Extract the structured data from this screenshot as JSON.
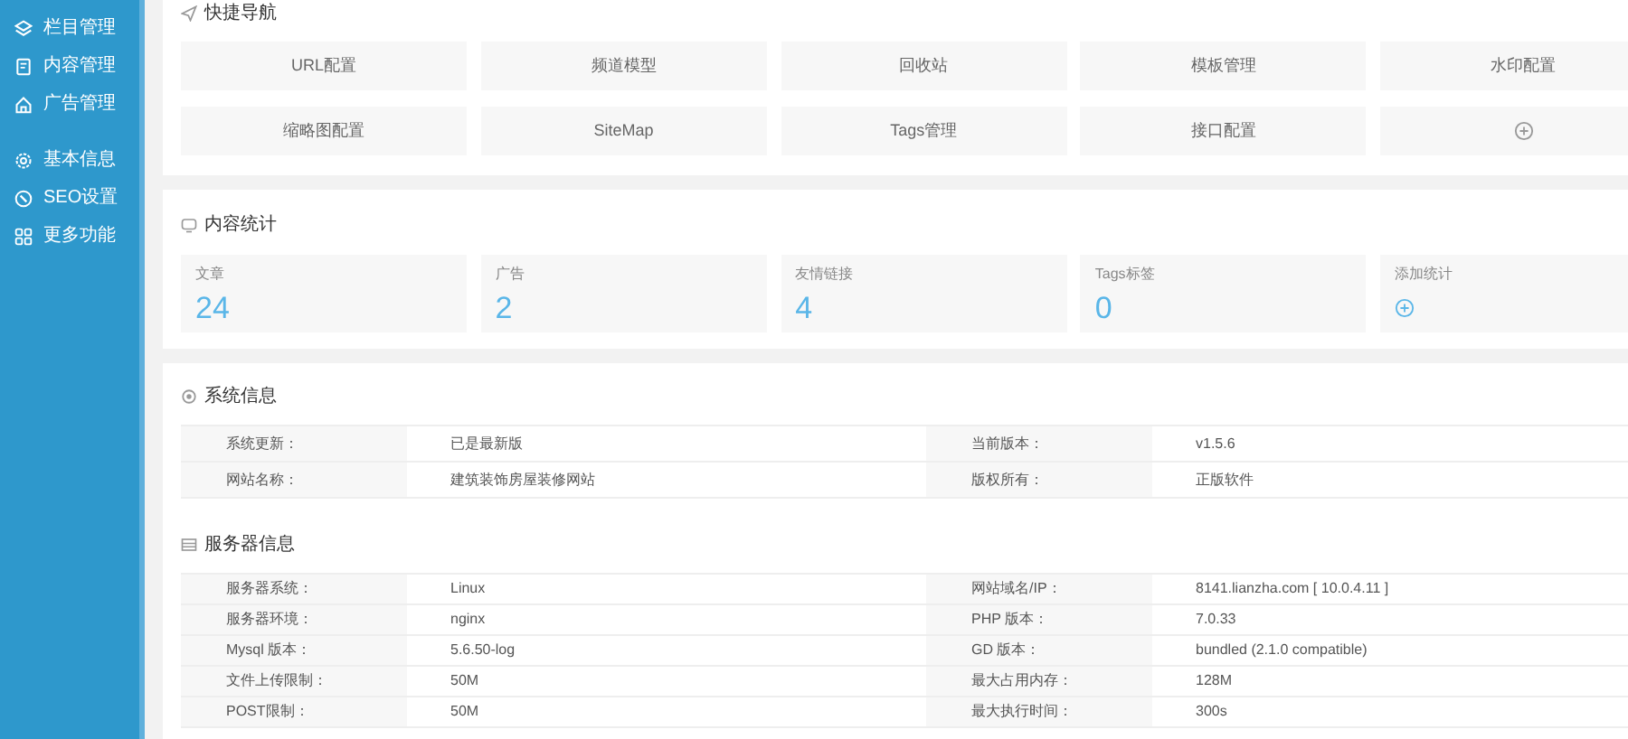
{
  "sidebar": {
    "groups": [
      {
        "items": [
          {
            "label": "栏目管理"
          },
          {
            "label": "内容管理"
          },
          {
            "label": "广告管理"
          }
        ]
      },
      {
        "items": [
          {
            "label": "基本信息"
          },
          {
            "label": "SEO设置"
          },
          {
            "label": "更多功能"
          }
        ]
      }
    ]
  },
  "quick_nav": {
    "title": "快捷导航",
    "items": [
      {
        "kind": "link",
        "label": "URL配置"
      },
      {
        "kind": "link",
        "label": "频道模型"
      },
      {
        "kind": "link",
        "label": "回收站"
      },
      {
        "kind": "link",
        "label": "模板管理"
      },
      {
        "kind": "link",
        "label": "水印配置"
      },
      {
        "kind": "link",
        "label": "缩略图配置"
      },
      {
        "kind": "link",
        "label": "SiteMap"
      },
      {
        "kind": "link",
        "label": "Tags管理"
      },
      {
        "kind": "link",
        "label": "接口配置"
      },
      {
        "kind": "add"
      }
    ]
  },
  "content_stats": {
    "title": "内容统计",
    "items": [
      {
        "kind": "stat",
        "label": "文章",
        "value": "24"
      },
      {
        "kind": "stat",
        "label": "广告",
        "value": "2"
      },
      {
        "kind": "stat",
        "label": "友情链接",
        "value": "4"
      },
      {
        "kind": "stat",
        "label": "Tags标签",
        "value": "0"
      },
      {
        "kind": "add",
        "label": "添加统计"
      }
    ]
  },
  "system_info": {
    "title": "系统信息",
    "rows": [
      {
        "label_1": "系统更新：",
        "value_1": "已是最新版",
        "label_2": "当前版本：",
        "value_2": "v1.5.6"
      },
      {
        "label_1": "网站名称：",
        "value_1": "建筑装饰房屋装修网站",
        "label_2": "版权所有：",
        "value_2": "正版软件"
      }
    ]
  },
  "server_info": {
    "title": "服务器信息",
    "rows": [
      {
        "label_1": "服务器系统：",
        "value_1": "Linux",
        "label_2": "网站域名/IP：",
        "value_2": "8141.lianzha.com [ 10.0.4.11 ]"
      },
      {
        "label_1": "服务器环境：",
        "value_1": "nginx",
        "label_2": "PHP 版本：",
        "value_2": "7.0.33"
      },
      {
        "label_1": "Mysql 版本：",
        "value_1": "5.6.50-log",
        "label_2": "GD 版本：",
        "value_2": "bundled (2.1.0 compatible)"
      },
      {
        "label_1": "文件上传限制：",
        "value_1": "50M",
        "label_2": "最大占用内存：",
        "value_2": "128M"
      },
      {
        "label_1": "POST限制：",
        "value_1": "50M",
        "label_2": "最大执行时间：",
        "value_2": "300s"
      }
    ]
  }
}
